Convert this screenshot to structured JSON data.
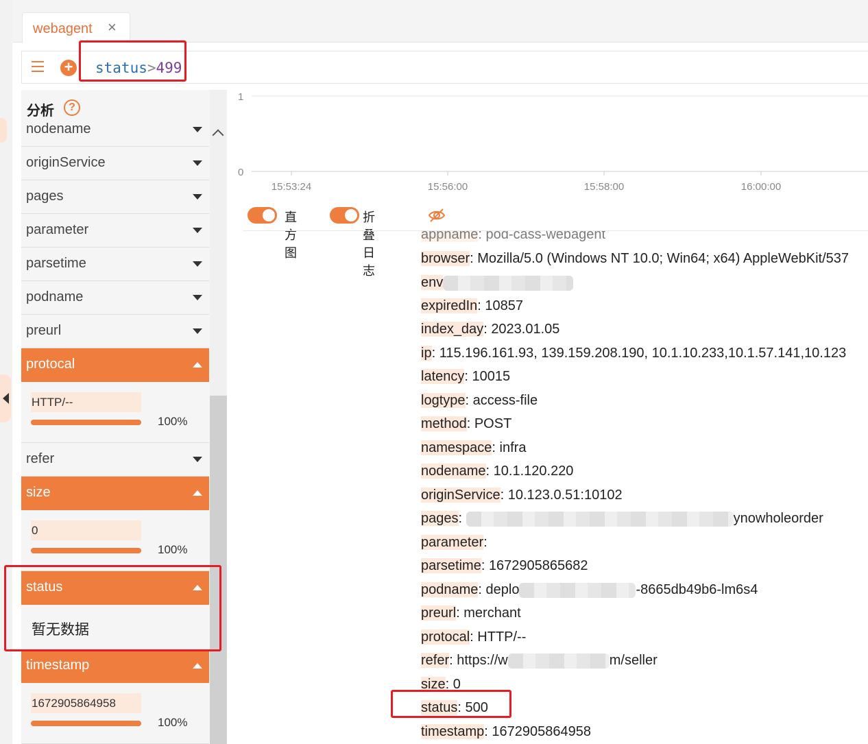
{
  "tab": {
    "label": "webagent",
    "close_glyph": "×"
  },
  "query": {
    "field": "status",
    "operator": ">",
    "value": "499"
  },
  "sidebar": {
    "title": "分析",
    "help_glyph": "?",
    "fields": [
      {
        "name": "nodename",
        "open": false
      },
      {
        "name": "originService",
        "open": false
      },
      {
        "name": "pages",
        "open": false
      },
      {
        "name": "parameter",
        "open": false
      },
      {
        "name": "parsetime",
        "open": false
      },
      {
        "name": "podname",
        "open": false
      },
      {
        "name": "preurl",
        "open": false
      },
      {
        "name": "protocal",
        "open": true,
        "value": "HTTP/--",
        "percent_label": "100%",
        "percent": 100
      },
      {
        "name": "refer",
        "open": false
      },
      {
        "name": "size",
        "open": true,
        "value": "0",
        "percent_label": "100%",
        "percent": 100
      },
      {
        "name": "status",
        "open": true,
        "empty": "暂无数据"
      },
      {
        "name": "timestamp",
        "open": true,
        "value": "1672905864958",
        "percent_label": "100%",
        "percent": 100
      }
    ]
  },
  "chart": {
    "y_ticks": [
      "1",
      "0"
    ],
    "x_ticks": [
      "15:53:24",
      "15:56:00",
      "15:58:00",
      "16:00:00"
    ]
  },
  "toggles": [
    {
      "label": "直方图",
      "on": true
    },
    {
      "label": "折叠日志",
      "on": true
    }
  ],
  "log_fields": [
    {
      "key": "appname",
      "sep": ": ",
      "value": "pod-cass-webagent"
    },
    {
      "key": "browser",
      "sep": ": ",
      "value": "Mozilla/5.0 (Windows NT 10.0; Win64; x64) AppleWebKit/537"
    },
    {
      "key": "env",
      "sep": "",
      "value": ""
    },
    {
      "key": "expiredIn",
      "sep": ": ",
      "value": "10857"
    },
    {
      "key": "index_day",
      "sep": ": ",
      "value": "2023.01.05"
    },
    {
      "key": "ip",
      "sep": ": ",
      "value": "115.196.161.93, 139.159.208.190, 10.1.10.233,10.1.57.141,10.123"
    },
    {
      "key": "latency",
      "sep": ": ",
      "value": "10015"
    },
    {
      "key": "logtype",
      "sep": ": ",
      "value": "access-file"
    },
    {
      "key": "method",
      "sep": ": ",
      "value": "POST"
    },
    {
      "key": "namespace",
      "sep": ": ",
      "value": "infra"
    },
    {
      "key": "nodename",
      "sep": ": ",
      "value": "10.1.120.220"
    },
    {
      "key": "originService",
      "sep": ": ",
      "value": "10.123.0.51:10102"
    },
    {
      "key": "pages",
      "sep": ": ",
      "value": "ynowholeorder"
    },
    {
      "key": "parameter",
      "sep": ":",
      "value": ""
    },
    {
      "key": "parsetime",
      "sep": ": ",
      "value": "1672905865682"
    },
    {
      "key": "podname",
      "sep": ": ",
      "value": "deplo",
      "value2": "-8665db49b6-lm6s4"
    },
    {
      "key": "preurl",
      "sep": ": ",
      "value": "merchant"
    },
    {
      "key": "protocal",
      "sep": ": ",
      "value": "HTTP/--"
    },
    {
      "key": "refer",
      "sep": ": ",
      "value": "https://w",
      "value2": "m/seller"
    },
    {
      "key": "size",
      "sep": ": ",
      "value": "0"
    },
    {
      "key": "status",
      "sep": ": ",
      "value": "500"
    },
    {
      "key": "timestamp",
      "sep": ": ",
      "value": "1672905864958"
    }
  ],
  "colors": {
    "accent": "#ef7d3d",
    "highlight": "#e51c23",
    "tab_text": "#e8713a"
  }
}
